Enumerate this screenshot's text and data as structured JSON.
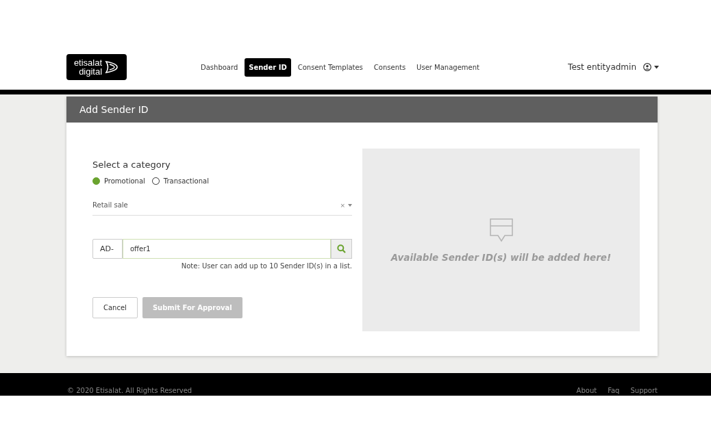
{
  "logo": {
    "line_1": "etisalat",
    "line_2": "digital"
  },
  "nav": [
    {
      "label": "Dashboard",
      "selected": false
    },
    {
      "label": "Sender ID",
      "selected": true
    },
    {
      "label": "Consent Templates",
      "selected": false
    },
    {
      "label": "Consents",
      "selected": false
    },
    {
      "label": "User Management",
      "selected": false
    }
  ],
  "user": {
    "name": "Test entityadmin"
  },
  "card": {
    "title": "Add Sender ID"
  },
  "form": {
    "category_label": "Select a category",
    "categories": [
      {
        "label": "Promotional",
        "selected": true
      },
      {
        "label": "Transactional",
        "selected": false
      }
    ],
    "subcategory": {
      "value": "Retail sale",
      "clear": "×"
    },
    "prefix": "AD-",
    "sender_id": {
      "value": "offer1"
    },
    "note": "Note: User can add up to 10 Sender ID(s) in a list.",
    "buttons": [
      {
        "label": "Cancel",
        "disabled": false
      },
      {
        "label": "Submit For Approval",
        "disabled": true
      }
    ]
  },
  "preview": {
    "message": "Available Sender ID(s) will be added here!"
  },
  "footer": {
    "copyright": "© 2020 Etisalat. All Rights Reserved",
    "links": [
      "About",
      "Faq",
      "Support"
    ]
  }
}
